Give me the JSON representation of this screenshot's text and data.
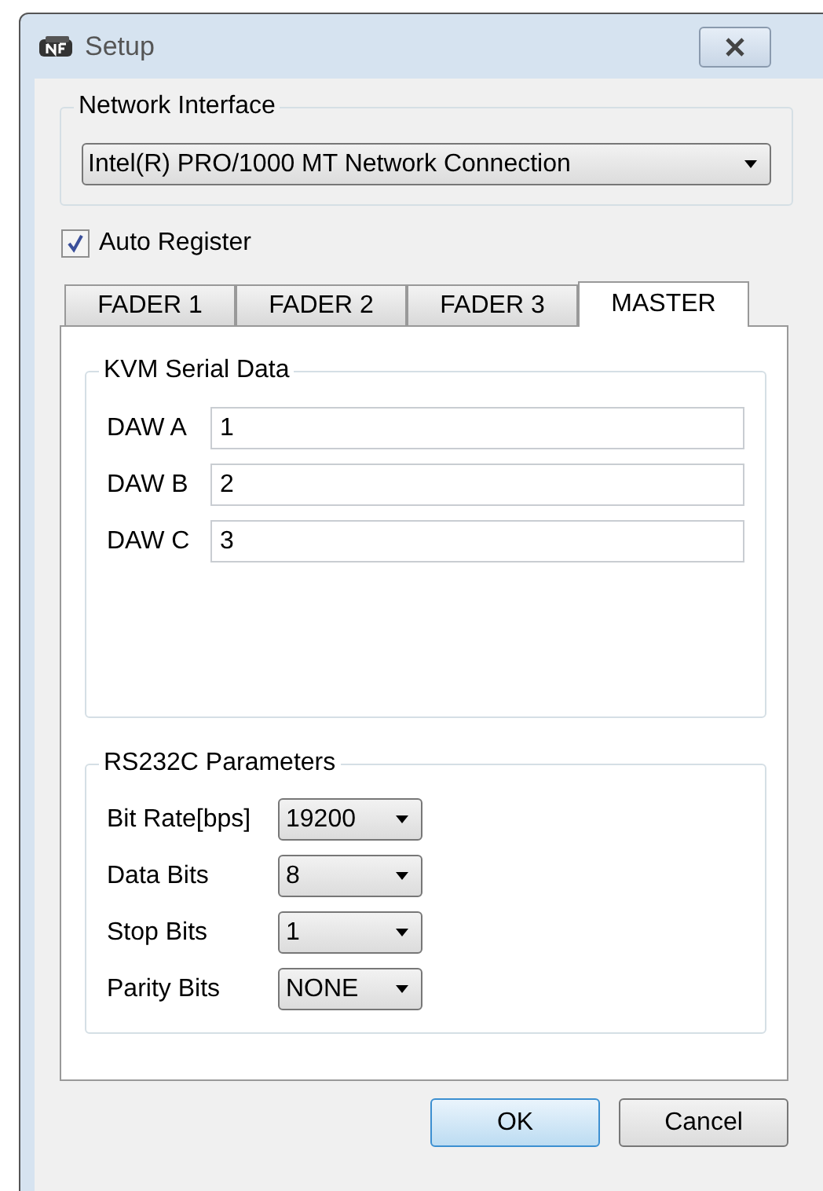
{
  "window": {
    "title": "Setup"
  },
  "network_interface": {
    "label": "Network Interface",
    "value": "Intel(R) PRO/1000 MT Network Connection"
  },
  "auto_register": {
    "label": "Auto Register",
    "checked": true
  },
  "tabs": [
    {
      "label": "FADER 1",
      "selected": false
    },
    {
      "label": "FADER 2",
      "selected": false
    },
    {
      "label": "FADER 3",
      "selected": false
    },
    {
      "label": "MASTER",
      "selected": true
    }
  ],
  "kvm_serial_data": {
    "label": "KVM Serial Data",
    "fields": [
      {
        "label": "DAW A",
        "value": "1"
      },
      {
        "label": "DAW B",
        "value": "2"
      },
      {
        "label": "DAW C",
        "value": "3"
      }
    ]
  },
  "rs232c_parameters": {
    "label": "RS232C Parameters",
    "fields": [
      {
        "label": "Bit Rate[bps]",
        "value": "19200"
      },
      {
        "label": "Data Bits",
        "value": "8"
      },
      {
        "label": "Stop Bits",
        "value": "1"
      },
      {
        "label": "Parity Bits",
        "value": "NONE"
      }
    ]
  },
  "buttons": [
    {
      "label": "OK",
      "default": true
    },
    {
      "label": "Cancel",
      "default": false
    }
  ]
}
